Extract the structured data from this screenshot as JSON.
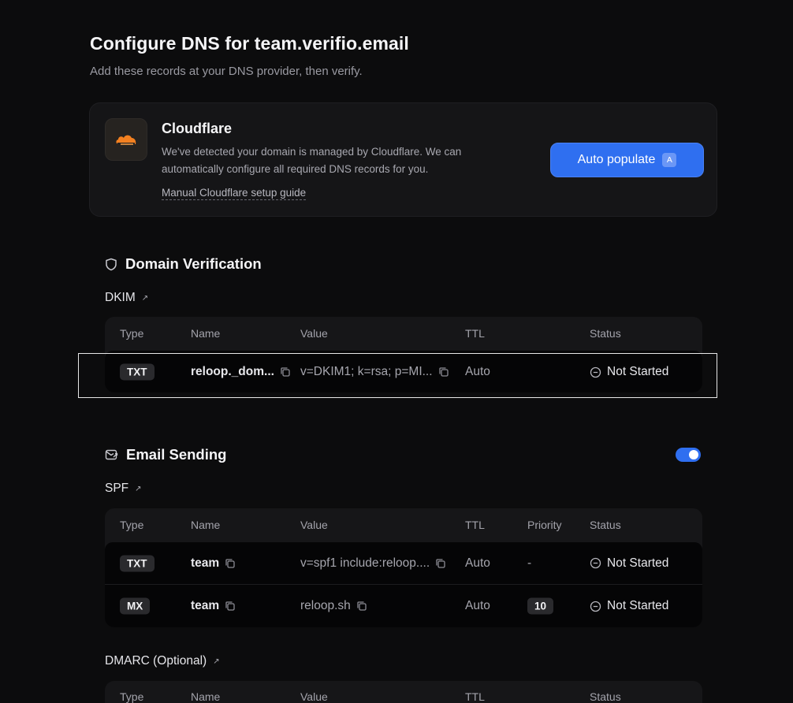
{
  "header": {
    "title": "Configure DNS for team.verifio.email",
    "subtitle": "Add these records at your DNS provider, then verify."
  },
  "provider": {
    "name": "Cloudflare",
    "description": "We've detected your domain is managed by Cloudflare. We can automatically configure all required DNS records for you.",
    "guide_link": "Manual Cloudflare setup guide",
    "button_label": "Auto populate",
    "button_shortcut": "A",
    "logo_color": "#f38020"
  },
  "domain_verification": {
    "title": "Domain Verification",
    "dkim": {
      "label": "DKIM",
      "headers": {
        "type": "Type",
        "name": "Name",
        "value": "Value",
        "ttl": "TTL",
        "status": "Status"
      },
      "rows": [
        {
          "type": "TXT",
          "name": "reloop._dom...",
          "value": "v=DKIM1; k=rsa; p=MI...",
          "ttl": "Auto",
          "status": "Not Started"
        }
      ]
    }
  },
  "email_sending": {
    "title": "Email Sending",
    "enabled": true,
    "spf": {
      "label": "SPF",
      "headers": {
        "type": "Type",
        "name": "Name",
        "value": "Value",
        "ttl": "TTL",
        "priority": "Priority",
        "status": "Status"
      },
      "rows": [
        {
          "type": "TXT",
          "name": "team",
          "value": "v=spf1 include:reloop....",
          "ttl": "Auto",
          "priority": "-",
          "status": "Not Started"
        },
        {
          "type": "MX",
          "name": "team",
          "value": "reloop.sh",
          "ttl": "Auto",
          "priority": "10",
          "status": "Not Started"
        }
      ]
    },
    "dmarc": {
      "label": "DMARC (Optional)",
      "headers": {
        "type": "Type",
        "name": "Name",
        "value": "Value",
        "ttl": "TTL",
        "status": "Status"
      }
    }
  },
  "colors": {
    "accent": "#2f6ff0",
    "background": "#0c0c0d"
  }
}
